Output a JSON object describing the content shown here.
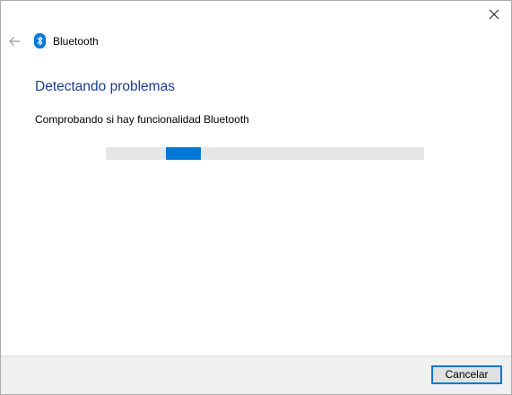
{
  "window": {
    "title": "Bluetooth",
    "close_icon": "close-icon",
    "back_icon": "back-arrow-icon",
    "app_icon": "bluetooth-icon"
  },
  "main": {
    "heading": "Detectando problemas",
    "status": "Comprobando si hay funcionalidad Bluetooth",
    "progress": {
      "type": "indeterminate",
      "chunk_start_fraction": 0.19,
      "chunk_end_fraction": 0.3
    }
  },
  "footer": {
    "cancel_label": "Cancelar"
  },
  "colors": {
    "accent": "#0078d7",
    "heading": "#1a3d8f",
    "progress_track": "#e6e6e6",
    "footer_bg": "#f0f0f0"
  }
}
